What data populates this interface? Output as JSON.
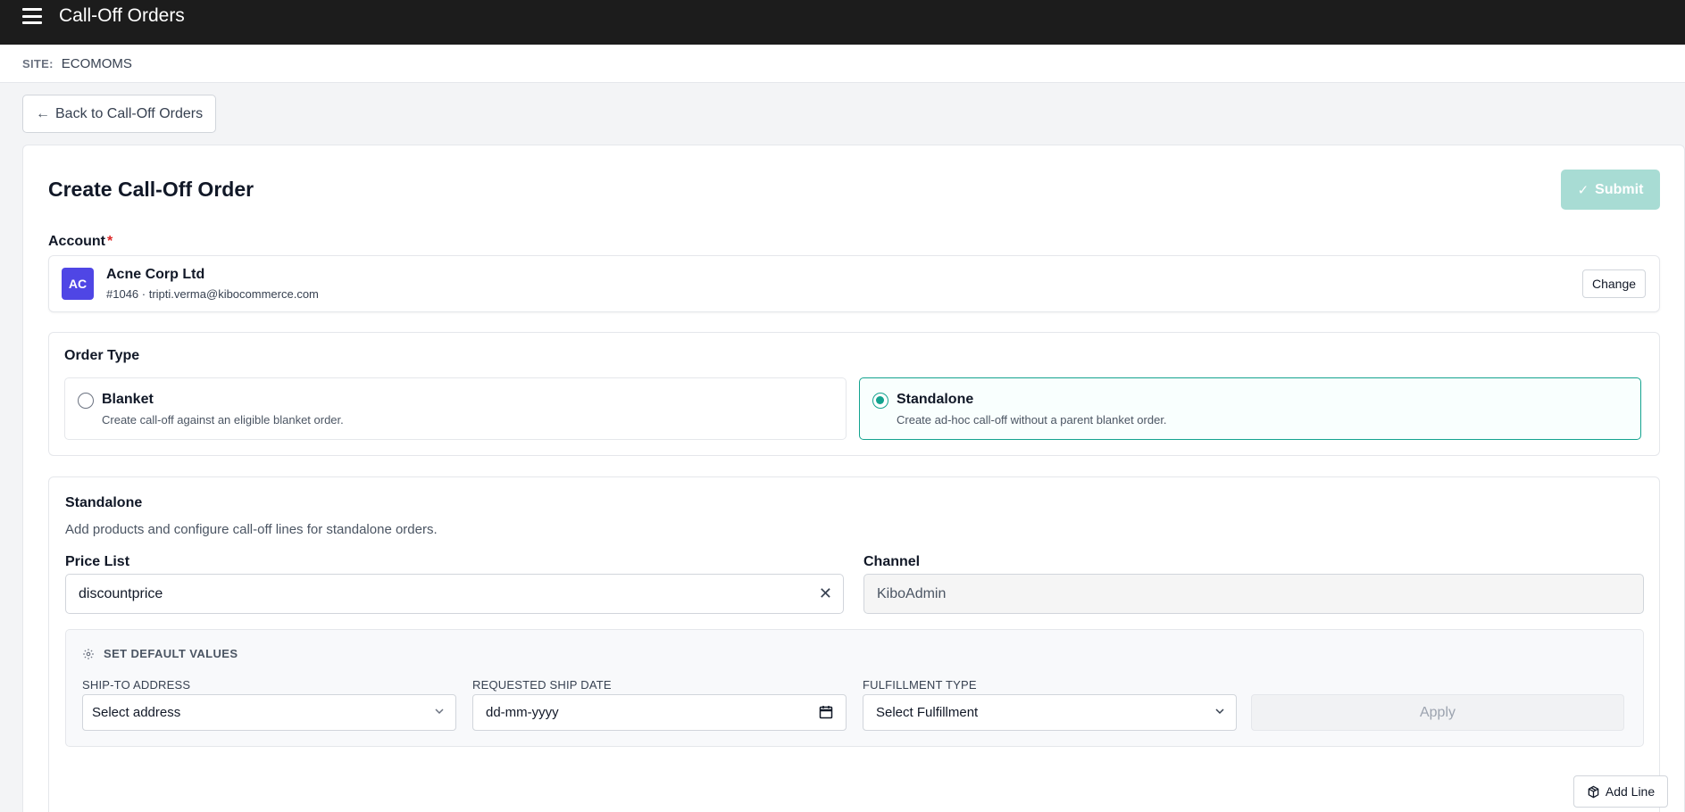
{
  "header": {
    "title": "Call-Off Orders"
  },
  "site": {
    "label": "SITE:",
    "value": "ECOMOMS"
  },
  "back": {
    "label": "Back to Call-Off Orders"
  },
  "page": {
    "title": "Create Call-Off Order",
    "submit_label": "Submit"
  },
  "account": {
    "label": "Account",
    "required_mark": "*",
    "initials": "AC",
    "name": "Acne Corp Ltd",
    "sub": "#1046 · tripti.verma@kibocommerce.com",
    "change_label": "Change"
  },
  "order_type": {
    "title": "Order Type",
    "options": [
      {
        "title": "Blanket",
        "desc": "Create call-off against an eligible blanket order.",
        "selected": false
      },
      {
        "title": "Standalone",
        "desc": "Create ad-hoc call-off without a parent blanket order.",
        "selected": true
      }
    ]
  },
  "standalone": {
    "title": "Standalone",
    "desc": "Add products and configure call-off lines for standalone orders.",
    "price_list": {
      "label": "Price List",
      "value": "discountprice"
    },
    "channel": {
      "label": "Channel",
      "value": "KiboAdmin"
    },
    "defaults": {
      "title": "SET DEFAULT VALUES",
      "ship_to": {
        "label": "SHIP-TO ADDRESS",
        "value": "Select address"
      },
      "ship_date": {
        "label": "REQUESTED SHIP DATE",
        "value": "dd-mm-yyyy"
      },
      "fulfillment": {
        "label": "FULFILLMENT TYPE",
        "value": "Select Fulfillment"
      },
      "apply_label": "Apply"
    },
    "add_line_label": "Add Line"
  },
  "colors": {
    "accent": "#14a38f",
    "submit_disabled": "#a8dcd4",
    "avatar": "#4f46e5",
    "topbar": "#1c1c1c"
  }
}
